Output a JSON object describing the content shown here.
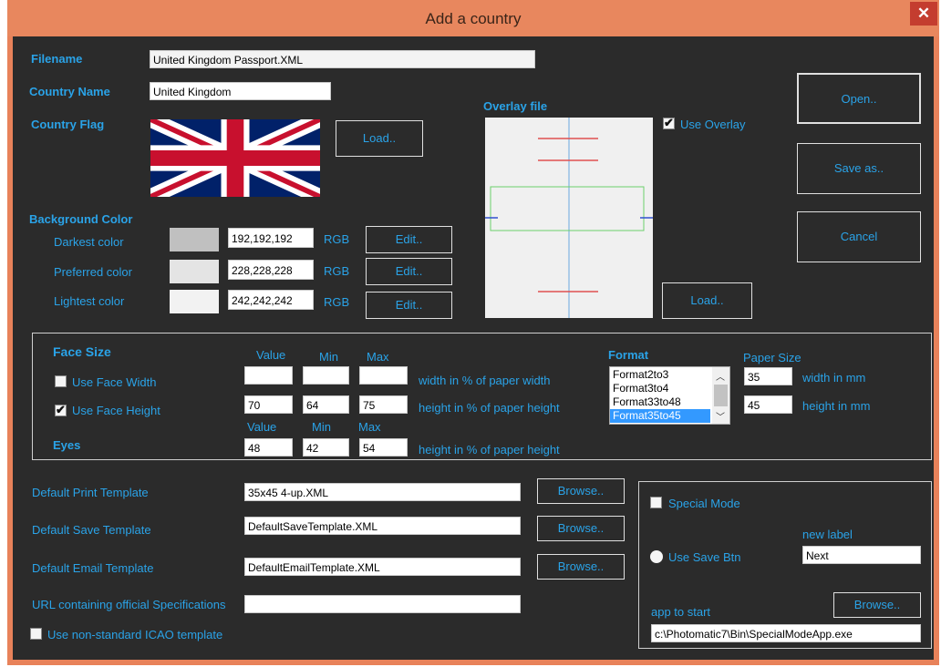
{
  "window": {
    "title": "Add a country",
    "close_glyph": "✕"
  },
  "file": {
    "filename_label": "Filename",
    "filename_value": "United Kingdom  Passport.XML",
    "country_name_label": "Country Name",
    "country_name_value": "United Kingdom",
    "country_flag_label": "Country Flag",
    "flag_load_label": "Load.."
  },
  "actions": {
    "open_label": "Open..",
    "save_as_label": "Save as..",
    "cancel_label": "Cancel"
  },
  "overlay": {
    "label": "Overlay file",
    "use_overlay_label": "Use Overlay",
    "use_overlay_checked": true,
    "load_label": "Load.."
  },
  "background": {
    "label": "Background Color",
    "rgb_label": "RGB",
    "edit_label": "Edit..",
    "rows": [
      {
        "label": "Darkest color",
        "value": "192,192,192",
        "color": "#c0c0c0"
      },
      {
        "label": "Preferred color",
        "value": "228,228,228",
        "color": "#e4e4e4"
      },
      {
        "label": "Lightest color",
        "value": "242,242,242",
        "color": "#f2f2f2"
      }
    ]
  },
  "face_size": {
    "label": "Face Size",
    "value_header": "Value",
    "min_header": "Min",
    "max_header": "Max",
    "use_face_width_label": "Use Face Width",
    "use_face_width_checked": false,
    "width_value": "",
    "width_min": "",
    "width_max": "",
    "width_desc": "width in % of paper width",
    "use_face_height_label": "Use Face Height",
    "use_face_height_checked": true,
    "height_value": "70",
    "height_min": "64",
    "height_max": "75",
    "height_desc": "height in % of paper height"
  },
  "eyes": {
    "label": "Eyes",
    "value_header": "Value",
    "min_header": "Min",
    "max_header": "Max",
    "value": "48",
    "min": "42",
    "max": "54",
    "desc": "height in % of paper height"
  },
  "format": {
    "label": "Format",
    "items": [
      "Format2to3",
      "Format3to4",
      "Format33to48",
      "Format35to45"
    ],
    "selected_index": 3
  },
  "paper_size": {
    "label": "Paper Size",
    "width": "35",
    "width_desc": "width in mm",
    "height": "45",
    "height_desc": "height in mm"
  },
  "templates": {
    "browse_label": "Browse..",
    "print_label": "Default Print Template",
    "print_value": "35x45 4-up.XML",
    "save_label": "Default Save Template",
    "save_value": "DefaultSaveTemplate.XML",
    "email_label": "Default Email Template",
    "email_value": "DefaultEmailTemplate.XML",
    "url_label": "URL containing official Specifications",
    "url_value": "",
    "non_standard_label": "Use non-standard ICAO template",
    "non_standard_checked": false
  },
  "special": {
    "special_mode_label": "Special Mode",
    "special_mode_checked": false,
    "new_label_label": "new label",
    "new_label_value": "Next",
    "use_save_btn_label": "Use Save Btn",
    "app_to_start_label": "app to start",
    "browse_label": "Browse..",
    "app_path": "c:\\Photomatic7\\Bin\\SpecialModeApp.exe"
  },
  "colors": {
    "accent": "#2aa3e8",
    "background": "#2b2b2b",
    "title_bar": "#e8875e",
    "close": "#c43d2f"
  }
}
